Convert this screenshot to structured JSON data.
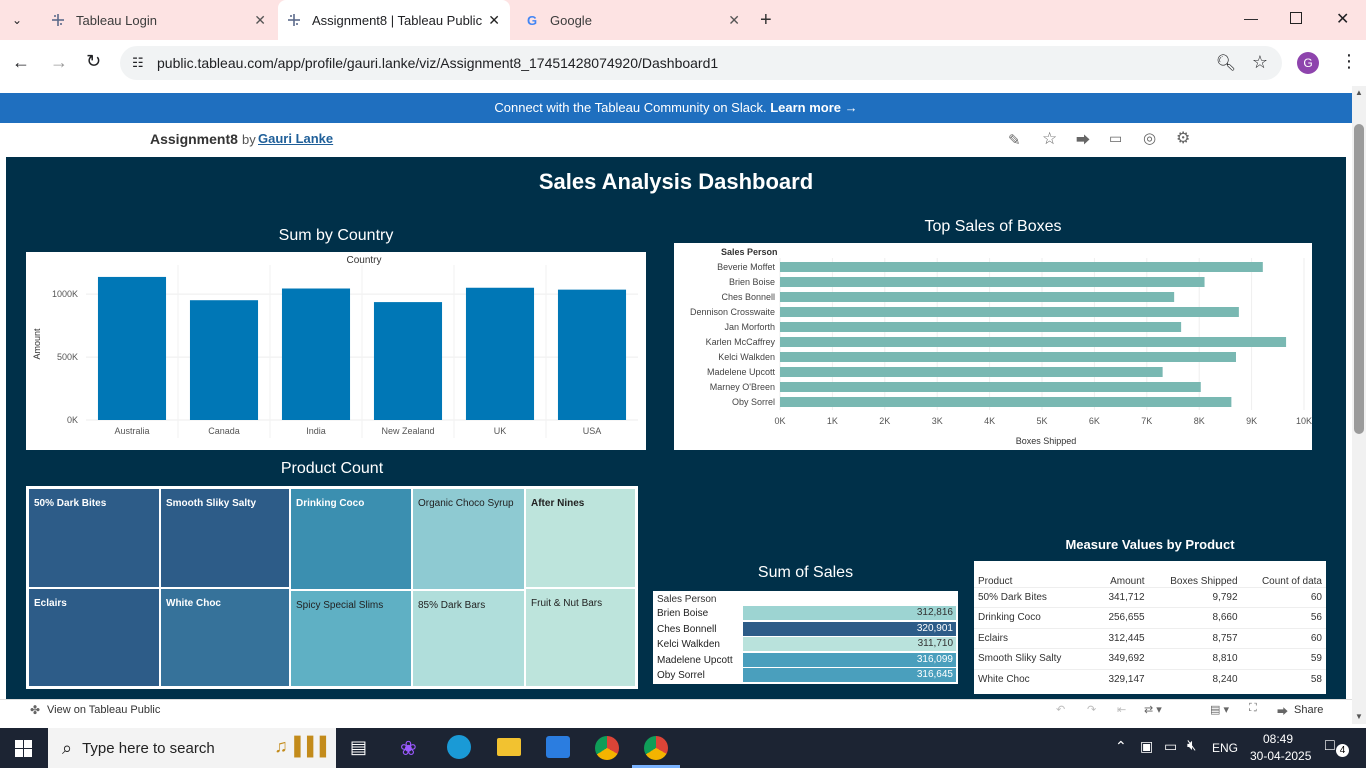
{
  "browser": {
    "tabs": [
      {
        "title": "Tableau Login",
        "active": false
      },
      {
        "title": "Assignment8 | Tableau Public",
        "active": true
      },
      {
        "title": "Google",
        "active": false
      }
    ],
    "url": "public.tableau.com/app/profile/gauri.lanke/viz/Assignment8_17451428074920/Dashboard1",
    "profile_letter": "G"
  },
  "banner": {
    "text": "Connect with the Tableau Community on Slack.",
    "link": "Learn more →"
  },
  "viz_header": {
    "title": "Assignment8",
    "by": "by",
    "author": "Gauri Lanke"
  },
  "dashboard": {
    "title": "Sales Analysis Dashboard",
    "sum_by_country": {
      "title": "Sum by Country",
      "header": "Country",
      "ylabel": "Amount",
      "yticks": [
        "1000K",
        "500K",
        "0K"
      ]
    },
    "top_sales": {
      "title": "Top Sales of Boxes",
      "header": "Sales Person",
      "xlabel": "Boxes Shipped",
      "xticks": [
        "0K",
        "1K",
        "2K",
        "3K",
        "4K",
        "5K",
        "6K",
        "7K",
        "8K",
        "9K",
        "10K"
      ]
    },
    "product_count": {
      "title": "Product Count",
      "cells": [
        {
          "label": "50% Dark Bites",
          "color": "#2d5c88"
        },
        {
          "label": "Smooth Sliky Salty",
          "color": "#2d5c88"
        },
        {
          "label": "Drinking Coco",
          "color": "#3b8fb0"
        },
        {
          "label": "Organic Choco Syrup",
          "color": "#8ecad2"
        },
        {
          "label": "After Nines",
          "color": "#bde4dc"
        },
        {
          "label": "Eclairs",
          "color": "#2d5c88"
        },
        {
          "label": "White Choc",
          "color": "#36729a"
        },
        {
          "label": "Spicy Special Slims",
          "color": "#5fb0c4"
        },
        {
          "label": "85% Dark Bars",
          "color": "#b0dedb"
        },
        {
          "label": "Fruit & Nut Bars",
          "color": "#bde4dc"
        }
      ]
    },
    "sum_of_sales": {
      "title": "Sum of Sales",
      "header": "Sales Person",
      "rows": [
        {
          "name": "Brien Boise",
          "value": "312,816",
          "color": "#9dd4d2"
        },
        {
          "name": "Ches Bonnell",
          "value": "320,901",
          "color": "#2d5c88"
        },
        {
          "name": "Kelci Walkden",
          "value": "311,710",
          "color": "#b9e2dc"
        },
        {
          "name": "Madelene Upcott",
          "value": "316,099",
          "color": "#4a9fbd"
        },
        {
          "name": "Oby Sorrel",
          "value": "316,645",
          "color": "#4a9fbd"
        }
      ]
    },
    "measure_values": {
      "title": "Measure Values by Product",
      "columns": [
        "Product",
        "Amount",
        "Boxes Shipped",
        "Count of data"
      ],
      "rows": [
        [
          "50% Dark Bites",
          "341,712",
          "9,792",
          "60"
        ],
        [
          "Drinking Coco",
          "256,655",
          "8,660",
          "56"
        ],
        [
          "Eclairs",
          "312,445",
          "8,757",
          "60"
        ],
        [
          "Smooth Sliky Salty",
          "349,692",
          "8,810",
          "59"
        ],
        [
          "White Choc",
          "329,147",
          "8,240",
          "58"
        ]
      ]
    }
  },
  "footer": {
    "view_on": "View on Tableau Public",
    "share": "Share"
  },
  "taskbar": {
    "search_placeholder": "Type here to search",
    "language": "ENG",
    "time": "08:49",
    "date": "30-04-2025",
    "notifications": "4"
  },
  "chart_data": [
    {
      "type": "bar",
      "title": "Sum by Country",
      "xlabel": "Country",
      "ylabel": "Amount",
      "categories": [
        "Australia",
        "Canada",
        "India",
        "New Zealand",
        "UK",
        "USA"
      ],
      "values": [
        1137000,
        952000,
        1045000,
        937000,
        1051000,
        1036000
      ],
      "ylim": [
        0,
        1200000
      ],
      "color": "#0077b6"
    },
    {
      "type": "bar",
      "orientation": "horizontal",
      "title": "Top Sales of Boxes",
      "xlabel": "Boxes Shipped",
      "ylabel": "Sales Person",
      "categories": [
        "Beverie Moffet",
        "Brien Boise",
        "Ches Bonnell",
        "Dennison Crosswaite",
        "Jan Morforth",
        "Karlen McCaffrey",
        "Kelci Walkden",
        "Madelene Upcott",
        "Marney O'Breen",
        "Oby Sorrel"
      ],
      "values": [
        9214,
        8102,
        7522,
        8757,
        7655,
        9658,
        8702,
        7302,
        8030,
        8614
      ],
      "xlim": [
        0,
        10000
      ],
      "color": "#79b8b2"
    }
  ]
}
